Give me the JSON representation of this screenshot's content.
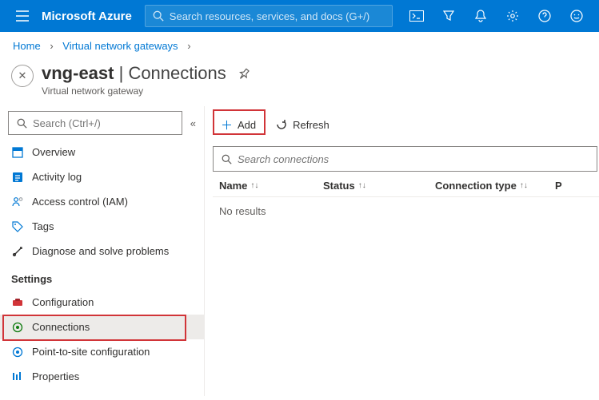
{
  "topbar": {
    "brand": "Microsoft Azure",
    "search_placeholder": "Search resources, services, and docs (G+/)"
  },
  "breadcrumb": {
    "home": "Home",
    "vng": "Virtual network gateways"
  },
  "header": {
    "name": "vng-east",
    "section": "Connections",
    "subtitle": "Virtual network gateway"
  },
  "sidebar": {
    "search_placeholder": "Search (Ctrl+/)",
    "items_top": [
      {
        "label": "Overview"
      },
      {
        "label": "Activity log"
      },
      {
        "label": "Access control (IAM)"
      },
      {
        "label": "Tags"
      },
      {
        "label": "Diagnose and solve problems"
      }
    ],
    "settings_head": "Settings",
    "items_settings": [
      {
        "label": "Configuration"
      },
      {
        "label": "Connections"
      },
      {
        "label": "Point-to-site configuration"
      },
      {
        "label": "Properties"
      }
    ]
  },
  "toolbar": {
    "add": "Add",
    "refresh": "Refresh"
  },
  "filter": {
    "placeholder": "Search connections"
  },
  "table": {
    "cols": {
      "name": "Name",
      "status": "Status",
      "type": "Connection type",
      "extra": "P"
    },
    "empty": "No results"
  }
}
